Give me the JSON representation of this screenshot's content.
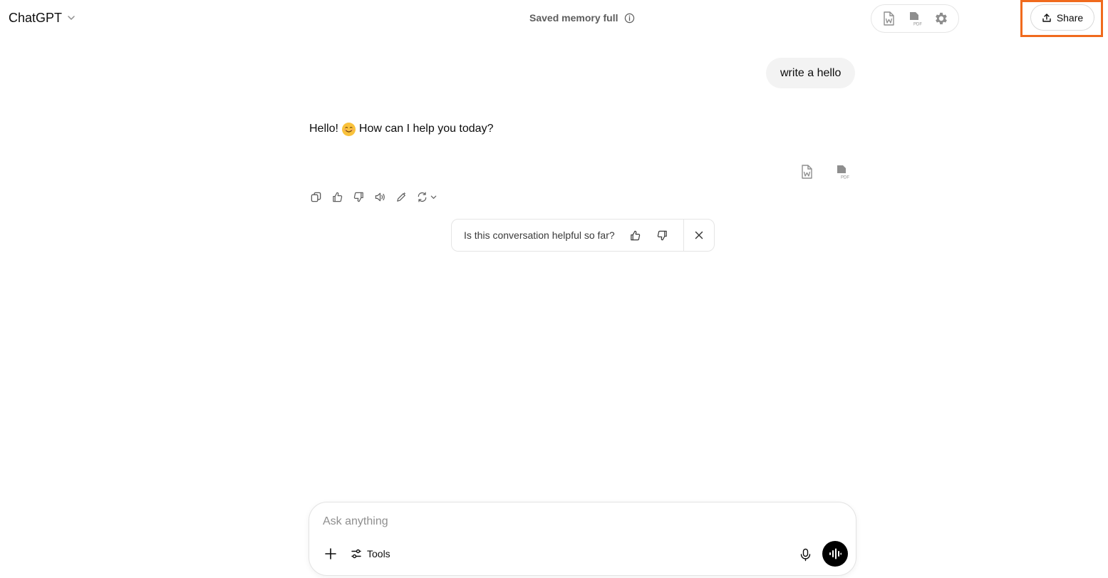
{
  "header": {
    "model_name": "ChatGPT",
    "memory_status": "Saved memory full",
    "share_label": "Share"
  },
  "toolbar": {
    "icons": [
      "word-doc-icon",
      "pdf-doc-icon",
      "gear-icon"
    ]
  },
  "conversation": {
    "user_message": "write a hello",
    "assistant_message_before_emoji": "Hello!",
    "assistant_emoji_icon": "smiling-face-icon",
    "assistant_message_after_emoji": "How can I help you today?",
    "message_actions": [
      "copy-icon",
      "thumbs-up-icon",
      "thumbs-down-icon",
      "read-aloud-icon",
      "edit-canvas-icon",
      "regenerate-icon"
    ],
    "export_icons": [
      "word-doc-icon",
      "pdf-doc-icon"
    ]
  },
  "feedback": {
    "question": "Is this conversation helpful so far?"
  },
  "composer": {
    "placeholder": "Ask anything",
    "tools_label": "Tools"
  },
  "colors": {
    "highlight": "#f06a1d",
    "bubble_bg": "#f3f3f3",
    "voice_button_bg": "#000000",
    "icon_gray": "#8e8e8e"
  }
}
